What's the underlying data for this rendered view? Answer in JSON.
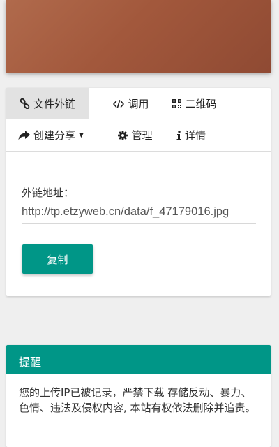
{
  "tabs_row1": [
    {
      "label": "文件外链",
      "icon": "link-icon",
      "active": true
    },
    {
      "label": "调用",
      "icon": "code-icon",
      "active": false
    },
    {
      "label": "二维码",
      "icon": "qrcode-icon",
      "active": false
    }
  ],
  "tabs_row2": [
    {
      "label": "创建分享",
      "icon": "share-icon",
      "dropdown": true
    },
    {
      "label": "管理",
      "icon": "gear-icon"
    },
    {
      "label": "详情",
      "icon": "info-icon"
    }
  ],
  "link": {
    "label": "外链地址：",
    "value": "http://tp.etzyweb.cn/data/f_47179016.jpg"
  },
  "copy_button": "复制",
  "notice": {
    "title": "提醒",
    "body": "您的上传IP已被记录，严禁下载 存储反动、暴力、色情、违法及侵权内容, 本站有权依法删除并追责。"
  },
  "colors": {
    "accent": "#009687",
    "active_tab_bg": "#e2e2e2",
    "page_bg": "#efefef"
  }
}
